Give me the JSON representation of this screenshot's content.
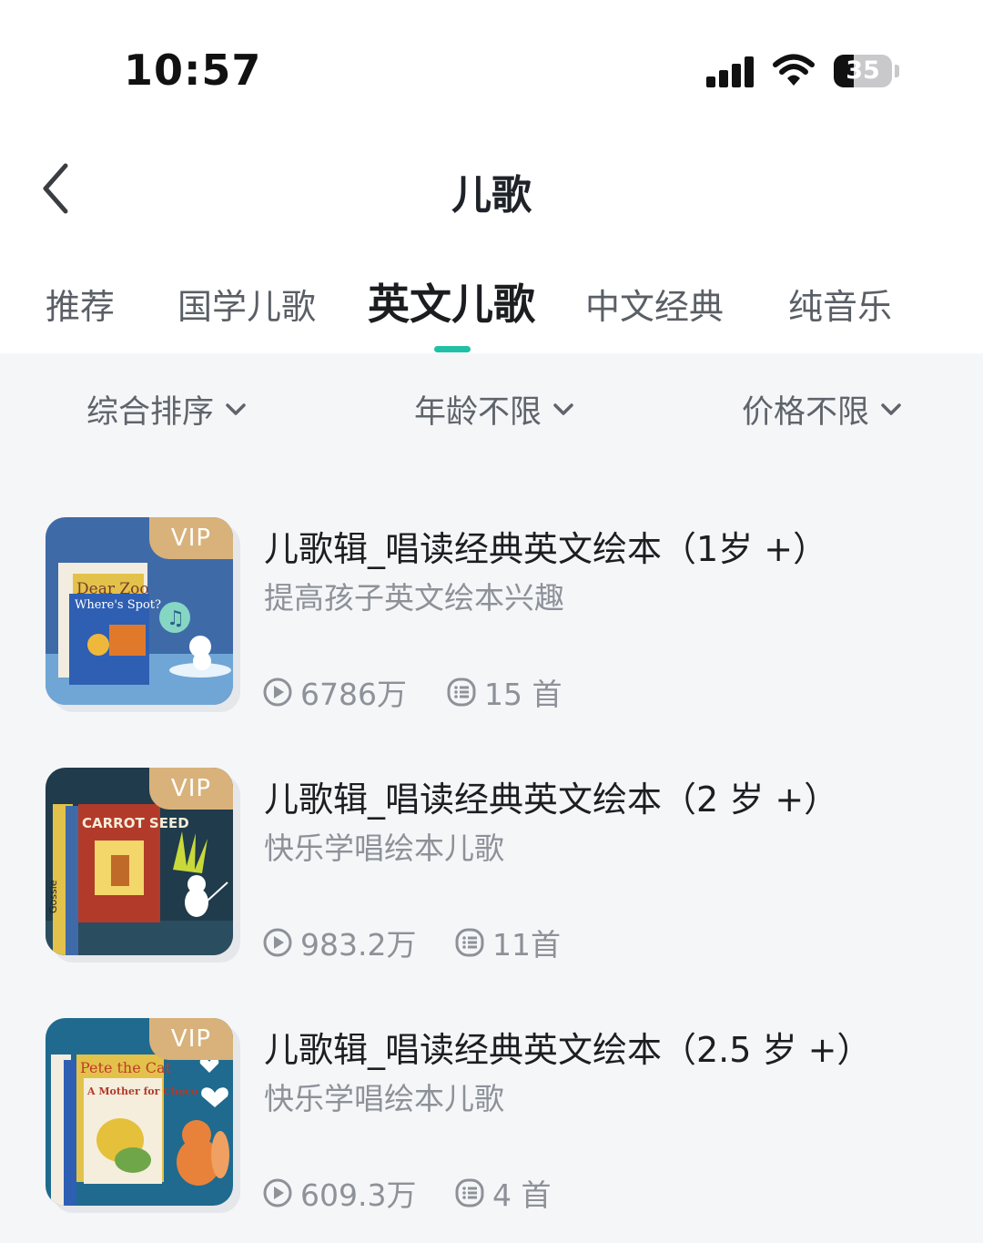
{
  "status_bar": {
    "time": "10:57",
    "battery": "35"
  },
  "nav": {
    "title": "儿歌"
  },
  "tabs": [
    {
      "label": "推荐"
    },
    {
      "label": "国学儿歌"
    },
    {
      "label": "英文儿歌",
      "active": true
    },
    {
      "label": "中文经典"
    },
    {
      "label": "纯音乐"
    }
  ],
  "filters": [
    {
      "label": "综合排序"
    },
    {
      "label": "年龄不限"
    },
    {
      "label": "价格不限"
    }
  ],
  "albums": [
    {
      "badge": "VIP",
      "title": "儿歌辑_唱读经典英文绘本（1岁 +）",
      "subtitle": "提高孩子英文绘本兴趣",
      "plays": "6786万",
      "tracks": "15 首",
      "cover_book_text": [
        "Dear Zoo",
        "Where's Spot?"
      ]
    },
    {
      "badge": "VIP",
      "title": "儿歌辑_唱读经典英文绘本（2 岁 +）",
      "subtitle": "快乐学唱绘本儿歌",
      "plays": "983.2万",
      "tracks": "11首",
      "cover_book_text": [
        "CARROT SEED",
        "Gossie"
      ]
    },
    {
      "badge": "VIP",
      "title": "儿歌辑_唱读经典英文绘本（2.5 岁 +）",
      "subtitle": "快乐学唱绘本儿歌",
      "plays": "609.3万",
      "tracks": "4 首",
      "cover_book_text": [
        "Pete the Cat",
        "A Mother for Choco"
      ]
    }
  ],
  "colors": {
    "accent": "#20c0a6",
    "vip": "#d8b27a"
  }
}
